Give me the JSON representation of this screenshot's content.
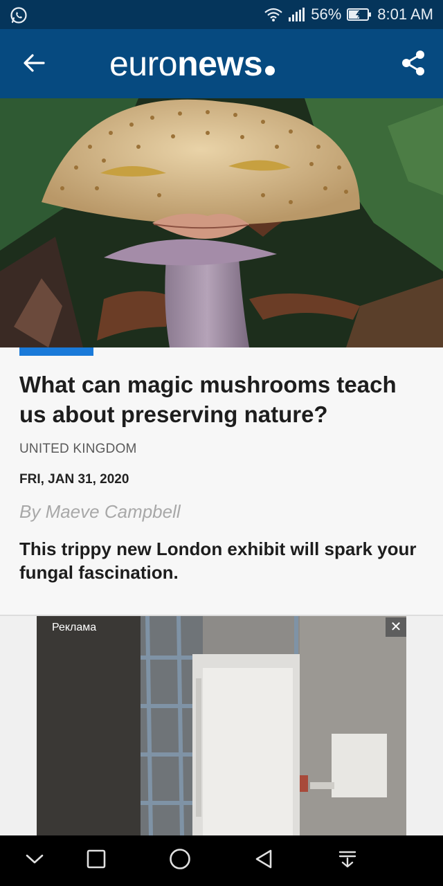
{
  "status_bar": {
    "battery": "56%",
    "time": "8:01 AM",
    "icons": [
      "whatsapp-icon",
      "wifi-icon",
      "signal-icon",
      "battery-icon"
    ]
  },
  "app_bar": {
    "brand_light": "euro",
    "brand_bold": "news",
    "icons": [
      "back-arrow-icon",
      "share-icon"
    ]
  },
  "article": {
    "headline": "What can magic mushrooms teach us about preserving nature?",
    "region": "UNITED KINGDOM",
    "date": "FRI, JAN 31, 2020",
    "byline": "By Maeve Campbell",
    "lede": "This trippy new London exhibit will spark your fungal fascination.",
    "accent_color": "#1a7ad9"
  },
  "ad": {
    "label": "Реклама",
    "close_symbol": "✕"
  },
  "nav_bar": {
    "icons": [
      "chevron-down-icon",
      "recent-apps-icon",
      "home-icon",
      "back-triangle-icon",
      "notifications-pull-icon"
    ]
  },
  "colors": {
    "status_bar": "#05355b",
    "app_bar": "#064a80"
  }
}
